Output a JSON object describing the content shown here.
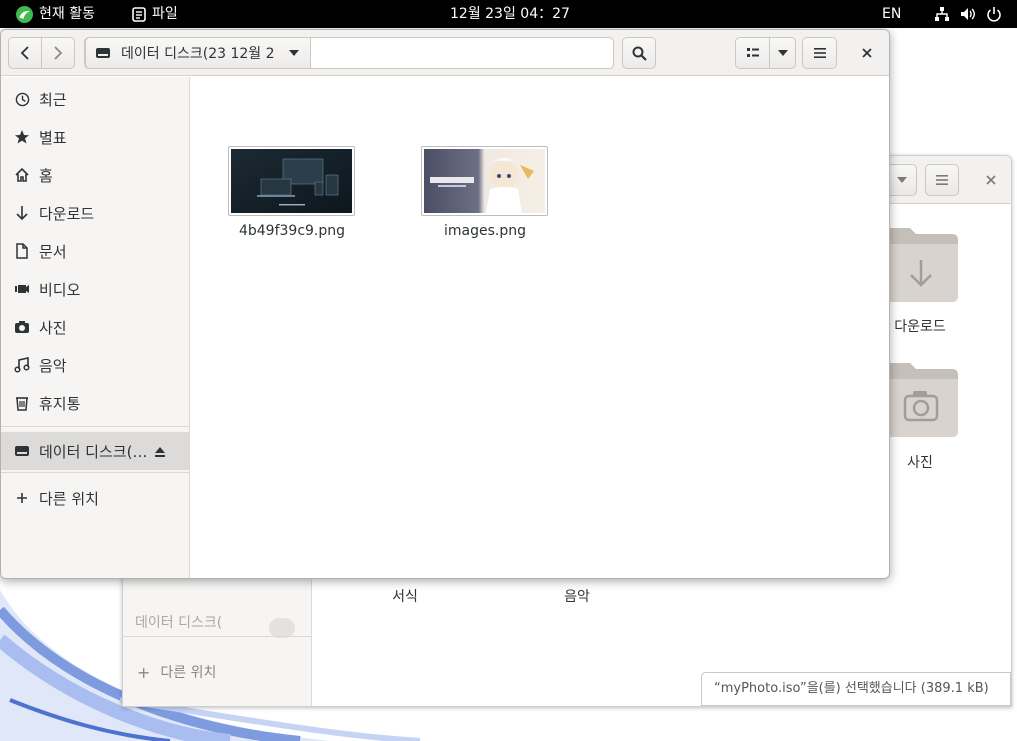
{
  "topbar": {
    "activities": "현재 활동",
    "app_name": "파일",
    "clock": "12월 23일 04：27",
    "input_method": "EN"
  },
  "window": {
    "path_label": "데이터 디스크(23 12월 2",
    "sidebar": {
      "items": [
        {
          "label": "최근",
          "icon": "clock-icon"
        },
        {
          "label": "별표",
          "icon": "star-icon"
        },
        {
          "label": "홈",
          "icon": "home-icon"
        },
        {
          "label": "다운로드",
          "icon": "download-icon"
        },
        {
          "label": "문서",
          "icon": "document-icon"
        },
        {
          "label": "비디오",
          "icon": "video-icon"
        },
        {
          "label": "사진",
          "icon": "camera-icon"
        },
        {
          "label": "음악",
          "icon": "music-icon"
        },
        {
          "label": "휴지통",
          "icon": "trash-icon"
        }
      ],
      "drive": {
        "label": "데이터 디스크(…",
        "icon": "drive-icon"
      },
      "other_locations": {
        "label": "다른 위치",
        "icon": "plus-icon"
      }
    },
    "files": [
      {
        "name": "4b49f39c9.png"
      },
      {
        "name": "images.png"
      }
    ]
  },
  "background_window": {
    "folders": [
      {
        "label": "다운로드",
        "icon": "download-folder-icon"
      },
      {
        "label": "사진",
        "icon": "pictures-folder-icon"
      }
    ],
    "bottom_labels": [
      "서식",
      "음악"
    ],
    "sidebar_drive_label": "데이터 디스크(",
    "sidebar_other_label": "다른 위치",
    "status": "“myPhoto.iso”을(를) 선택했습니다 (389.1 kB)"
  },
  "colors": {
    "accent_green": "#3fb950",
    "header_bg": "#f2f1f0",
    "sidebar_bg": "#f6f5f4",
    "selected_row": "#dcdbda"
  }
}
